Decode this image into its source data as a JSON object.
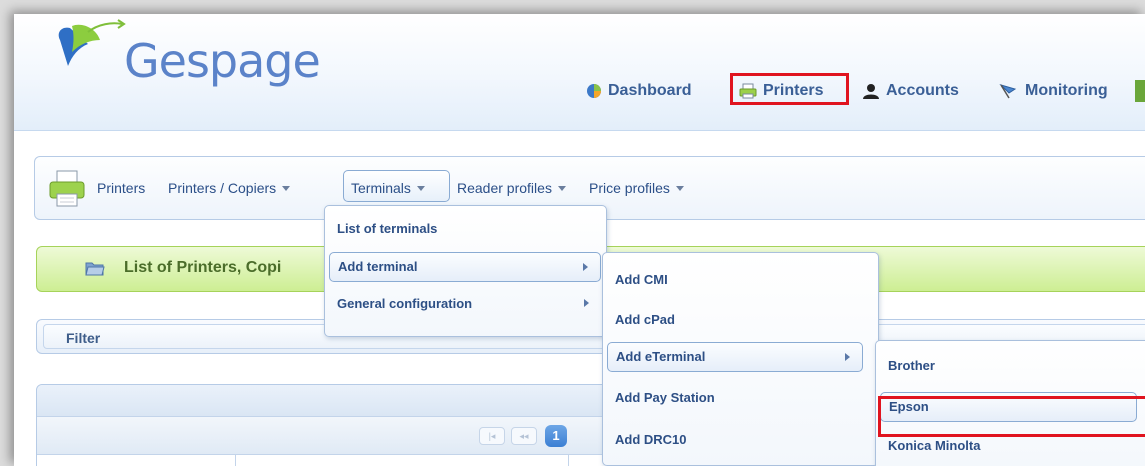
{
  "header": {
    "logo_text": "Gespage",
    "nav": [
      {
        "label": "Dashboard",
        "icon": "dashboard-icon"
      },
      {
        "label": "Printers",
        "icon": "printer-icon"
      },
      {
        "label": "Accounts",
        "icon": "user-icon"
      },
      {
        "label": "Monitoring",
        "icon": "monitoring-icon"
      }
    ]
  },
  "subnav": {
    "section": "Printers",
    "items": [
      {
        "label": "Printers / Copiers",
        "dropdown": true
      },
      {
        "label": "Terminals",
        "dropdown": true,
        "open": true
      },
      {
        "label": "Reader profiles",
        "dropdown": true
      },
      {
        "label": "Price profiles",
        "dropdown": true
      }
    ]
  },
  "terminals_menu": {
    "items": [
      {
        "label": "List of terminals",
        "submenu": false
      },
      {
        "label": "Add terminal",
        "submenu": true,
        "highlighted": true
      },
      {
        "label": "General configuration",
        "submenu": true
      }
    ]
  },
  "add_terminal_menu": {
    "items": [
      {
        "label": "Add CMI"
      },
      {
        "label": "Add cPad"
      },
      {
        "label": "Add eTerminal",
        "submenu": true,
        "highlighted": true
      },
      {
        "label": "Add Pay Station"
      },
      {
        "label": "Add DRC10"
      }
    ]
  },
  "eterminal_menu": {
    "items": [
      {
        "label": "Brother"
      },
      {
        "label": "Epson",
        "highlighted": true,
        "annotated": true
      },
      {
        "label": "Konica Minolta"
      }
    ]
  },
  "content": {
    "section_title": "List of Printers, Copi",
    "filter_label": "Filter",
    "pager": {
      "current_page": "1",
      "first_label": "|◂",
      "prev_label": "◂◂"
    }
  },
  "colors": {
    "annotation_red": "#e0141f",
    "link_blue": "#2d4f85",
    "green_bar": "#cdee93",
    "logo_blue": "#5b83c9"
  }
}
